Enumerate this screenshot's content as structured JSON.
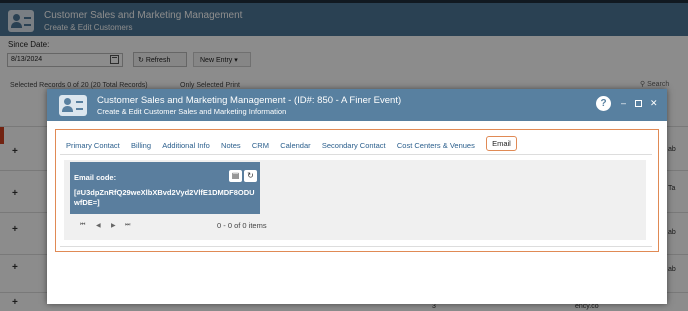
{
  "app": {
    "title": "Customer Sales and Marketing Management",
    "subtitle": "Create & Edit Customers"
  },
  "toolbar": {
    "since_label": "Since Date:",
    "date_value": "8/13/2024",
    "refresh_label": "Refresh",
    "new_entry_label": "New Entry"
  },
  "grid": {
    "records_text": "Selected Records 0 of 20 (20 Total Records)",
    "only_selected_text": "Only Selected Print",
    "search_placeholder": "Search",
    "side_texts": [
      "ab",
      "Ta",
      "ab",
      "ab"
    ],
    "bottom_texts": [
      "3",
      "ency.co"
    ]
  },
  "modal": {
    "title": "Customer Sales and Marketing Management - (ID#: 850 - A Finer Event)",
    "subtitle": "Create & Edit Customer Sales and Marketing Information",
    "help": "?",
    "tabs": [
      {
        "label": "Primary Contact"
      },
      {
        "label": "Billing"
      },
      {
        "label": "Additional Info"
      },
      {
        "label": "Notes"
      },
      {
        "label": "CRM"
      },
      {
        "label": "Calendar"
      },
      {
        "label": "Secondary Contact"
      },
      {
        "label": "Cost Centers & Venues"
      },
      {
        "label": "Email"
      }
    ],
    "active_tab": "Email",
    "email_code_label": "Email code:",
    "email_code_value": "[#U3dpZnRfQ29weXlbXBvd2Vyd2VlfE1DMDF8ODUwfDE=]",
    "pager_info": "0 - 0 of 0 items"
  }
}
